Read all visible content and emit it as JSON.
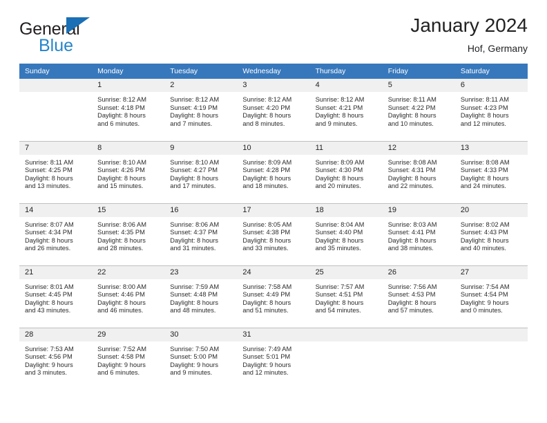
{
  "brand": {
    "line1": "General",
    "line2": "Blue",
    "logo_icon": "triangle-logo-icon",
    "accent_color": "#2585c9"
  },
  "header": {
    "title": "January 2024",
    "location": "Hof, Germany",
    "header_bg_color": "#3778bc"
  },
  "calendar": {
    "weekday_headers": [
      "Sunday",
      "Monday",
      "Tuesday",
      "Wednesday",
      "Thursday",
      "Friday",
      "Saturday"
    ],
    "weeks": [
      [
        {
          "day": "",
          "sunrise": "",
          "sunset": "",
          "daylight_line1": "",
          "daylight_line2": ""
        },
        {
          "day": "1",
          "sunrise": "Sunrise: 8:12 AM",
          "sunset": "Sunset: 4:18 PM",
          "daylight_line1": "Daylight: 8 hours",
          "daylight_line2": "and 6 minutes."
        },
        {
          "day": "2",
          "sunrise": "Sunrise: 8:12 AM",
          "sunset": "Sunset: 4:19 PM",
          "daylight_line1": "Daylight: 8 hours",
          "daylight_line2": "and 7 minutes."
        },
        {
          "day": "3",
          "sunrise": "Sunrise: 8:12 AM",
          "sunset": "Sunset: 4:20 PM",
          "daylight_line1": "Daylight: 8 hours",
          "daylight_line2": "and 8 minutes."
        },
        {
          "day": "4",
          "sunrise": "Sunrise: 8:12 AM",
          "sunset": "Sunset: 4:21 PM",
          "daylight_line1": "Daylight: 8 hours",
          "daylight_line2": "and 9 minutes."
        },
        {
          "day": "5",
          "sunrise": "Sunrise: 8:11 AM",
          "sunset": "Sunset: 4:22 PM",
          "daylight_line1": "Daylight: 8 hours",
          "daylight_line2": "and 10 minutes."
        },
        {
          "day": "6",
          "sunrise": "Sunrise: 8:11 AM",
          "sunset": "Sunset: 4:23 PM",
          "daylight_line1": "Daylight: 8 hours",
          "daylight_line2": "and 12 minutes."
        }
      ],
      [
        {
          "day": "7",
          "sunrise": "Sunrise: 8:11 AM",
          "sunset": "Sunset: 4:25 PM",
          "daylight_line1": "Daylight: 8 hours",
          "daylight_line2": "and 13 minutes."
        },
        {
          "day": "8",
          "sunrise": "Sunrise: 8:10 AM",
          "sunset": "Sunset: 4:26 PM",
          "daylight_line1": "Daylight: 8 hours",
          "daylight_line2": "and 15 minutes."
        },
        {
          "day": "9",
          "sunrise": "Sunrise: 8:10 AM",
          "sunset": "Sunset: 4:27 PM",
          "daylight_line1": "Daylight: 8 hours",
          "daylight_line2": "and 17 minutes."
        },
        {
          "day": "10",
          "sunrise": "Sunrise: 8:09 AM",
          "sunset": "Sunset: 4:28 PM",
          "daylight_line1": "Daylight: 8 hours",
          "daylight_line2": "and 18 minutes."
        },
        {
          "day": "11",
          "sunrise": "Sunrise: 8:09 AM",
          "sunset": "Sunset: 4:30 PM",
          "daylight_line1": "Daylight: 8 hours",
          "daylight_line2": "and 20 minutes."
        },
        {
          "day": "12",
          "sunrise": "Sunrise: 8:08 AM",
          "sunset": "Sunset: 4:31 PM",
          "daylight_line1": "Daylight: 8 hours",
          "daylight_line2": "and 22 minutes."
        },
        {
          "day": "13",
          "sunrise": "Sunrise: 8:08 AM",
          "sunset": "Sunset: 4:33 PM",
          "daylight_line1": "Daylight: 8 hours",
          "daylight_line2": "and 24 minutes."
        }
      ],
      [
        {
          "day": "14",
          "sunrise": "Sunrise: 8:07 AM",
          "sunset": "Sunset: 4:34 PM",
          "daylight_line1": "Daylight: 8 hours",
          "daylight_line2": "and 26 minutes."
        },
        {
          "day": "15",
          "sunrise": "Sunrise: 8:06 AM",
          "sunset": "Sunset: 4:35 PM",
          "daylight_line1": "Daylight: 8 hours",
          "daylight_line2": "and 28 minutes."
        },
        {
          "day": "16",
          "sunrise": "Sunrise: 8:06 AM",
          "sunset": "Sunset: 4:37 PM",
          "daylight_line1": "Daylight: 8 hours",
          "daylight_line2": "and 31 minutes."
        },
        {
          "day": "17",
          "sunrise": "Sunrise: 8:05 AM",
          "sunset": "Sunset: 4:38 PM",
          "daylight_line1": "Daylight: 8 hours",
          "daylight_line2": "and 33 minutes."
        },
        {
          "day": "18",
          "sunrise": "Sunrise: 8:04 AM",
          "sunset": "Sunset: 4:40 PM",
          "daylight_line1": "Daylight: 8 hours",
          "daylight_line2": "and 35 minutes."
        },
        {
          "day": "19",
          "sunrise": "Sunrise: 8:03 AM",
          "sunset": "Sunset: 4:41 PM",
          "daylight_line1": "Daylight: 8 hours",
          "daylight_line2": "and 38 minutes."
        },
        {
          "day": "20",
          "sunrise": "Sunrise: 8:02 AM",
          "sunset": "Sunset: 4:43 PM",
          "daylight_line1": "Daylight: 8 hours",
          "daylight_line2": "and 40 minutes."
        }
      ],
      [
        {
          "day": "21",
          "sunrise": "Sunrise: 8:01 AM",
          "sunset": "Sunset: 4:45 PM",
          "daylight_line1": "Daylight: 8 hours",
          "daylight_line2": "and 43 minutes."
        },
        {
          "day": "22",
          "sunrise": "Sunrise: 8:00 AM",
          "sunset": "Sunset: 4:46 PM",
          "daylight_line1": "Daylight: 8 hours",
          "daylight_line2": "and 46 minutes."
        },
        {
          "day": "23",
          "sunrise": "Sunrise: 7:59 AM",
          "sunset": "Sunset: 4:48 PM",
          "daylight_line1": "Daylight: 8 hours",
          "daylight_line2": "and 48 minutes."
        },
        {
          "day": "24",
          "sunrise": "Sunrise: 7:58 AM",
          "sunset": "Sunset: 4:49 PM",
          "daylight_line1": "Daylight: 8 hours",
          "daylight_line2": "and 51 minutes."
        },
        {
          "day": "25",
          "sunrise": "Sunrise: 7:57 AM",
          "sunset": "Sunset: 4:51 PM",
          "daylight_line1": "Daylight: 8 hours",
          "daylight_line2": "and 54 minutes."
        },
        {
          "day": "26",
          "sunrise": "Sunrise: 7:56 AM",
          "sunset": "Sunset: 4:53 PM",
          "daylight_line1": "Daylight: 8 hours",
          "daylight_line2": "and 57 minutes."
        },
        {
          "day": "27",
          "sunrise": "Sunrise: 7:54 AM",
          "sunset": "Sunset: 4:54 PM",
          "daylight_line1": "Daylight: 9 hours",
          "daylight_line2": "and 0 minutes."
        }
      ],
      [
        {
          "day": "28",
          "sunrise": "Sunrise: 7:53 AM",
          "sunset": "Sunset: 4:56 PM",
          "daylight_line1": "Daylight: 9 hours",
          "daylight_line2": "and 3 minutes."
        },
        {
          "day": "29",
          "sunrise": "Sunrise: 7:52 AM",
          "sunset": "Sunset: 4:58 PM",
          "daylight_line1": "Daylight: 9 hours",
          "daylight_line2": "and 6 minutes."
        },
        {
          "day": "30",
          "sunrise": "Sunrise: 7:50 AM",
          "sunset": "Sunset: 5:00 PM",
          "daylight_line1": "Daylight: 9 hours",
          "daylight_line2": "and 9 minutes."
        },
        {
          "day": "31",
          "sunrise": "Sunrise: 7:49 AM",
          "sunset": "Sunset: 5:01 PM",
          "daylight_line1": "Daylight: 9 hours",
          "daylight_line2": "and 12 minutes."
        },
        {
          "day": "",
          "sunrise": "",
          "sunset": "",
          "daylight_line1": "",
          "daylight_line2": ""
        },
        {
          "day": "",
          "sunrise": "",
          "sunset": "",
          "daylight_line1": "",
          "daylight_line2": ""
        },
        {
          "day": "",
          "sunrise": "",
          "sunset": "",
          "daylight_line1": "",
          "daylight_line2": ""
        }
      ]
    ]
  }
}
